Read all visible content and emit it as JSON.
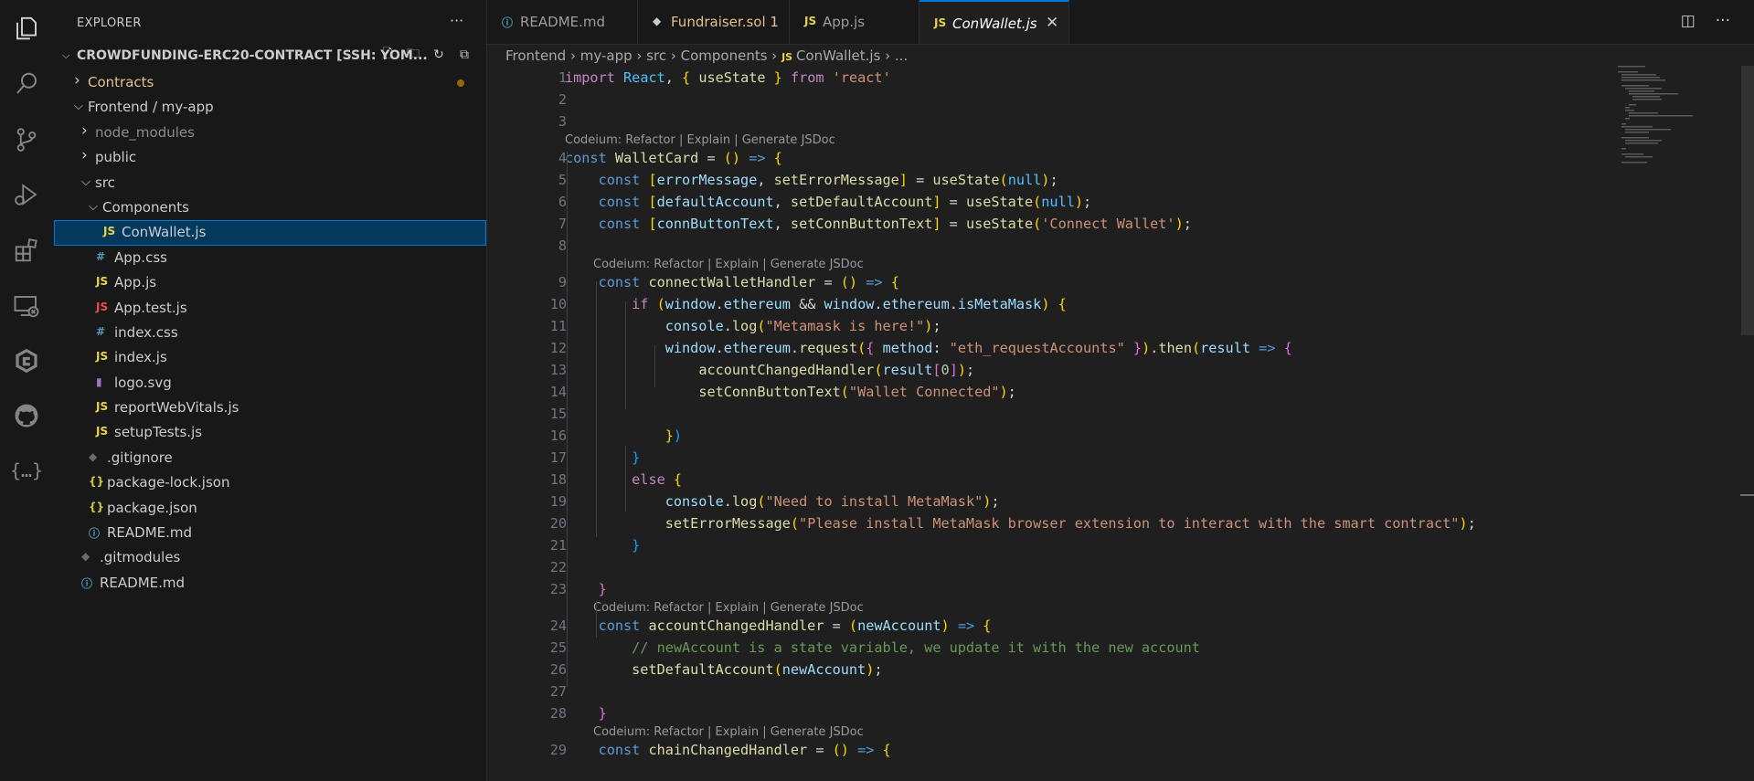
{
  "activity_bar": [
    "explorer-icon",
    "search-icon",
    "source-control-icon",
    "run-debug-icon",
    "extensions-icon",
    "remote-explorer-icon",
    "codeium-icon",
    "github-icon",
    "json-icon"
  ],
  "sidebar": {
    "title": "EXPLORER",
    "more": "···",
    "project": "CROWDFUNDING-ERC20-CONTRACT [SSH: YOM...",
    "tree": [
      {
        "label": "Contracts",
        "type": "folder",
        "open": false,
        "depth": 0,
        "color": "#e2c08d",
        "modified": true
      },
      {
        "label": "Frontend / my-app",
        "type": "folder",
        "open": true,
        "depth": 0
      },
      {
        "label": "node_modules",
        "type": "folder",
        "open": false,
        "depth": 1,
        "color": "#8c8c8c"
      },
      {
        "label": "public",
        "type": "folder",
        "open": false,
        "depth": 1
      },
      {
        "label": "src",
        "type": "folder",
        "open": true,
        "depth": 1
      },
      {
        "label": "Components",
        "type": "folder",
        "open": true,
        "depth": 2
      },
      {
        "label": "ConWallet.js",
        "type": "js",
        "depth": 3,
        "selected": true
      },
      {
        "label": "App.css",
        "type": "css",
        "depth": 2
      },
      {
        "label": "App.js",
        "type": "js",
        "depth": 2
      },
      {
        "label": "App.test.js",
        "type": "test",
        "depth": 2
      },
      {
        "label": "index.css",
        "type": "css",
        "depth": 2
      },
      {
        "label": "index.js",
        "type": "js",
        "depth": 2
      },
      {
        "label": "logo.svg",
        "type": "svg",
        "depth": 2
      },
      {
        "label": "reportWebVitals.js",
        "type": "js",
        "depth": 2
      },
      {
        "label": "setupTests.js",
        "type": "js",
        "depth": 2
      },
      {
        "label": ".gitignore",
        "type": "git",
        "depth": 1
      },
      {
        "label": "package-lock.json",
        "type": "json",
        "depth": 1
      },
      {
        "label": "package.json",
        "type": "json",
        "depth": 1
      },
      {
        "label": "README.md",
        "type": "info",
        "depth": 1
      },
      {
        "label": ".gitmodules",
        "type": "git",
        "depth": 0
      },
      {
        "label": "README.md",
        "type": "info",
        "depth": 0
      }
    ]
  },
  "tabs": [
    {
      "label": "README.md",
      "icon": "info",
      "active": false
    },
    {
      "label": "Fundraiser.sol 1",
      "icon": "sol",
      "active": false,
      "color": "#e2c08d"
    },
    {
      "label": "App.js",
      "icon": "js",
      "active": false
    },
    {
      "label": "ConWallet.js",
      "icon": "js",
      "active": true
    }
  ],
  "breadcrumb": [
    "Frontend",
    "my-app",
    "src",
    "Components",
    "ConWallet.js",
    "..."
  ],
  "codelens": "Codeium: Refactor | Explain | Generate JSDoc",
  "code": [
    {
      "n": "1",
      "t": "import React, { useState } from 'react'"
    },
    {
      "n": "2",
      "t": ""
    },
    {
      "n": "3",
      "t": ""
    },
    {
      "lens": true,
      "indent": 0
    },
    {
      "n": "4",
      "t": "const WalletCard = () => {"
    },
    {
      "n": "5",
      "t": "    const [errorMessage, setErrorMessage] = useState(null);"
    },
    {
      "n": "6",
      "t": "    const [defaultAccount, setDefaultAccount] = useState(null);"
    },
    {
      "n": "7",
      "t": "    const [connButtonText, setConnButtonText] = useState('Connect Wallet');"
    },
    {
      "n": "8",
      "t": ""
    },
    {
      "lens": true,
      "indent": 1
    },
    {
      "n": "9",
      "t": "    const connectWalletHandler = () => {"
    },
    {
      "n": "10",
      "t": "        if (window.ethereum && window.ethereum.isMetaMask) {"
    },
    {
      "n": "11",
      "t": "            console.log(\"Metamask is here!\");"
    },
    {
      "n": "12",
      "t": "            window.ethereum.request({ method: \"eth_requestAccounts\" }).then(result => {"
    },
    {
      "n": "13",
      "t": "                accountChangedHandler(result[0]);"
    },
    {
      "n": "14",
      "t": "                setConnButtonText(\"Wallet Connected\");"
    },
    {
      "n": "15",
      "t": ""
    },
    {
      "n": "16",
      "t": "            })"
    },
    {
      "n": "17",
      "t": "        }"
    },
    {
      "n": "18",
      "t": "        else {"
    },
    {
      "n": "19",
      "t": "            console.log(\"Need to install MetaMask\");"
    },
    {
      "n": "20",
      "t": "            setErrorMessage(\"Please install MetaMask browser extension to interact with the smart contract\");"
    },
    {
      "n": "21",
      "t": "        }"
    },
    {
      "n": "22",
      "t": ""
    },
    {
      "n": "23",
      "t": "    }"
    },
    {
      "lens": true,
      "indent": 1
    },
    {
      "n": "24",
      "t": "    const accountChangedHandler = (newAccount) => {"
    },
    {
      "n": "25",
      "t": "        // newAccount is a state variable, we update it with the new account"
    },
    {
      "n": "26",
      "t": "        setDefaultAccount(newAccount);"
    },
    {
      "n": "27",
      "t": ""
    },
    {
      "n": "28",
      "t": "    }"
    },
    {
      "lens": true,
      "indent": 1
    },
    {
      "n": "29",
      "t": "    const chainChangedHandler = () => {"
    }
  ]
}
